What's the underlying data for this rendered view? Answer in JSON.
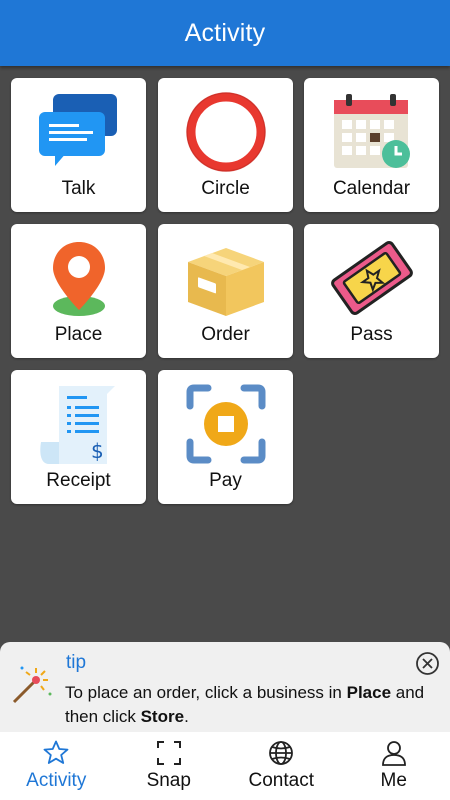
{
  "header": {
    "title": "Activity"
  },
  "tiles": [
    {
      "label": "Talk",
      "icon": "chat-bubbles-icon"
    },
    {
      "label": "Circle",
      "icon": "circle-ring-icon"
    },
    {
      "label": "Calendar",
      "icon": "calendar-clock-icon"
    },
    {
      "label": "Place",
      "icon": "map-pin-icon"
    },
    {
      "label": "Order",
      "icon": "package-box-icon"
    },
    {
      "label": "Pass",
      "icon": "ticket-icon"
    },
    {
      "label": "Receipt",
      "icon": "receipt-icon"
    },
    {
      "label": "Pay",
      "icon": "scan-pay-icon"
    }
  ],
  "tip": {
    "title": "tip",
    "text_before": "To place an order, click a business in ",
    "bold1": "Place",
    "text_middle": " and then click ",
    "bold2": "Store",
    "text_after": "."
  },
  "tabbar": {
    "items": [
      {
        "label": "Activity",
        "icon": "star-icon",
        "active": true
      },
      {
        "label": "Snap",
        "icon": "scan-frame-icon",
        "active": false
      },
      {
        "label": "Contact",
        "icon": "globe-icon",
        "active": false
      },
      {
        "label": "Me",
        "icon": "person-icon",
        "active": false
      }
    ]
  },
  "colors": {
    "accent": "#1f77d6",
    "background": "#4a4a4a",
    "tile": "#ffffff",
    "tip_bg": "#f0f0f0"
  }
}
